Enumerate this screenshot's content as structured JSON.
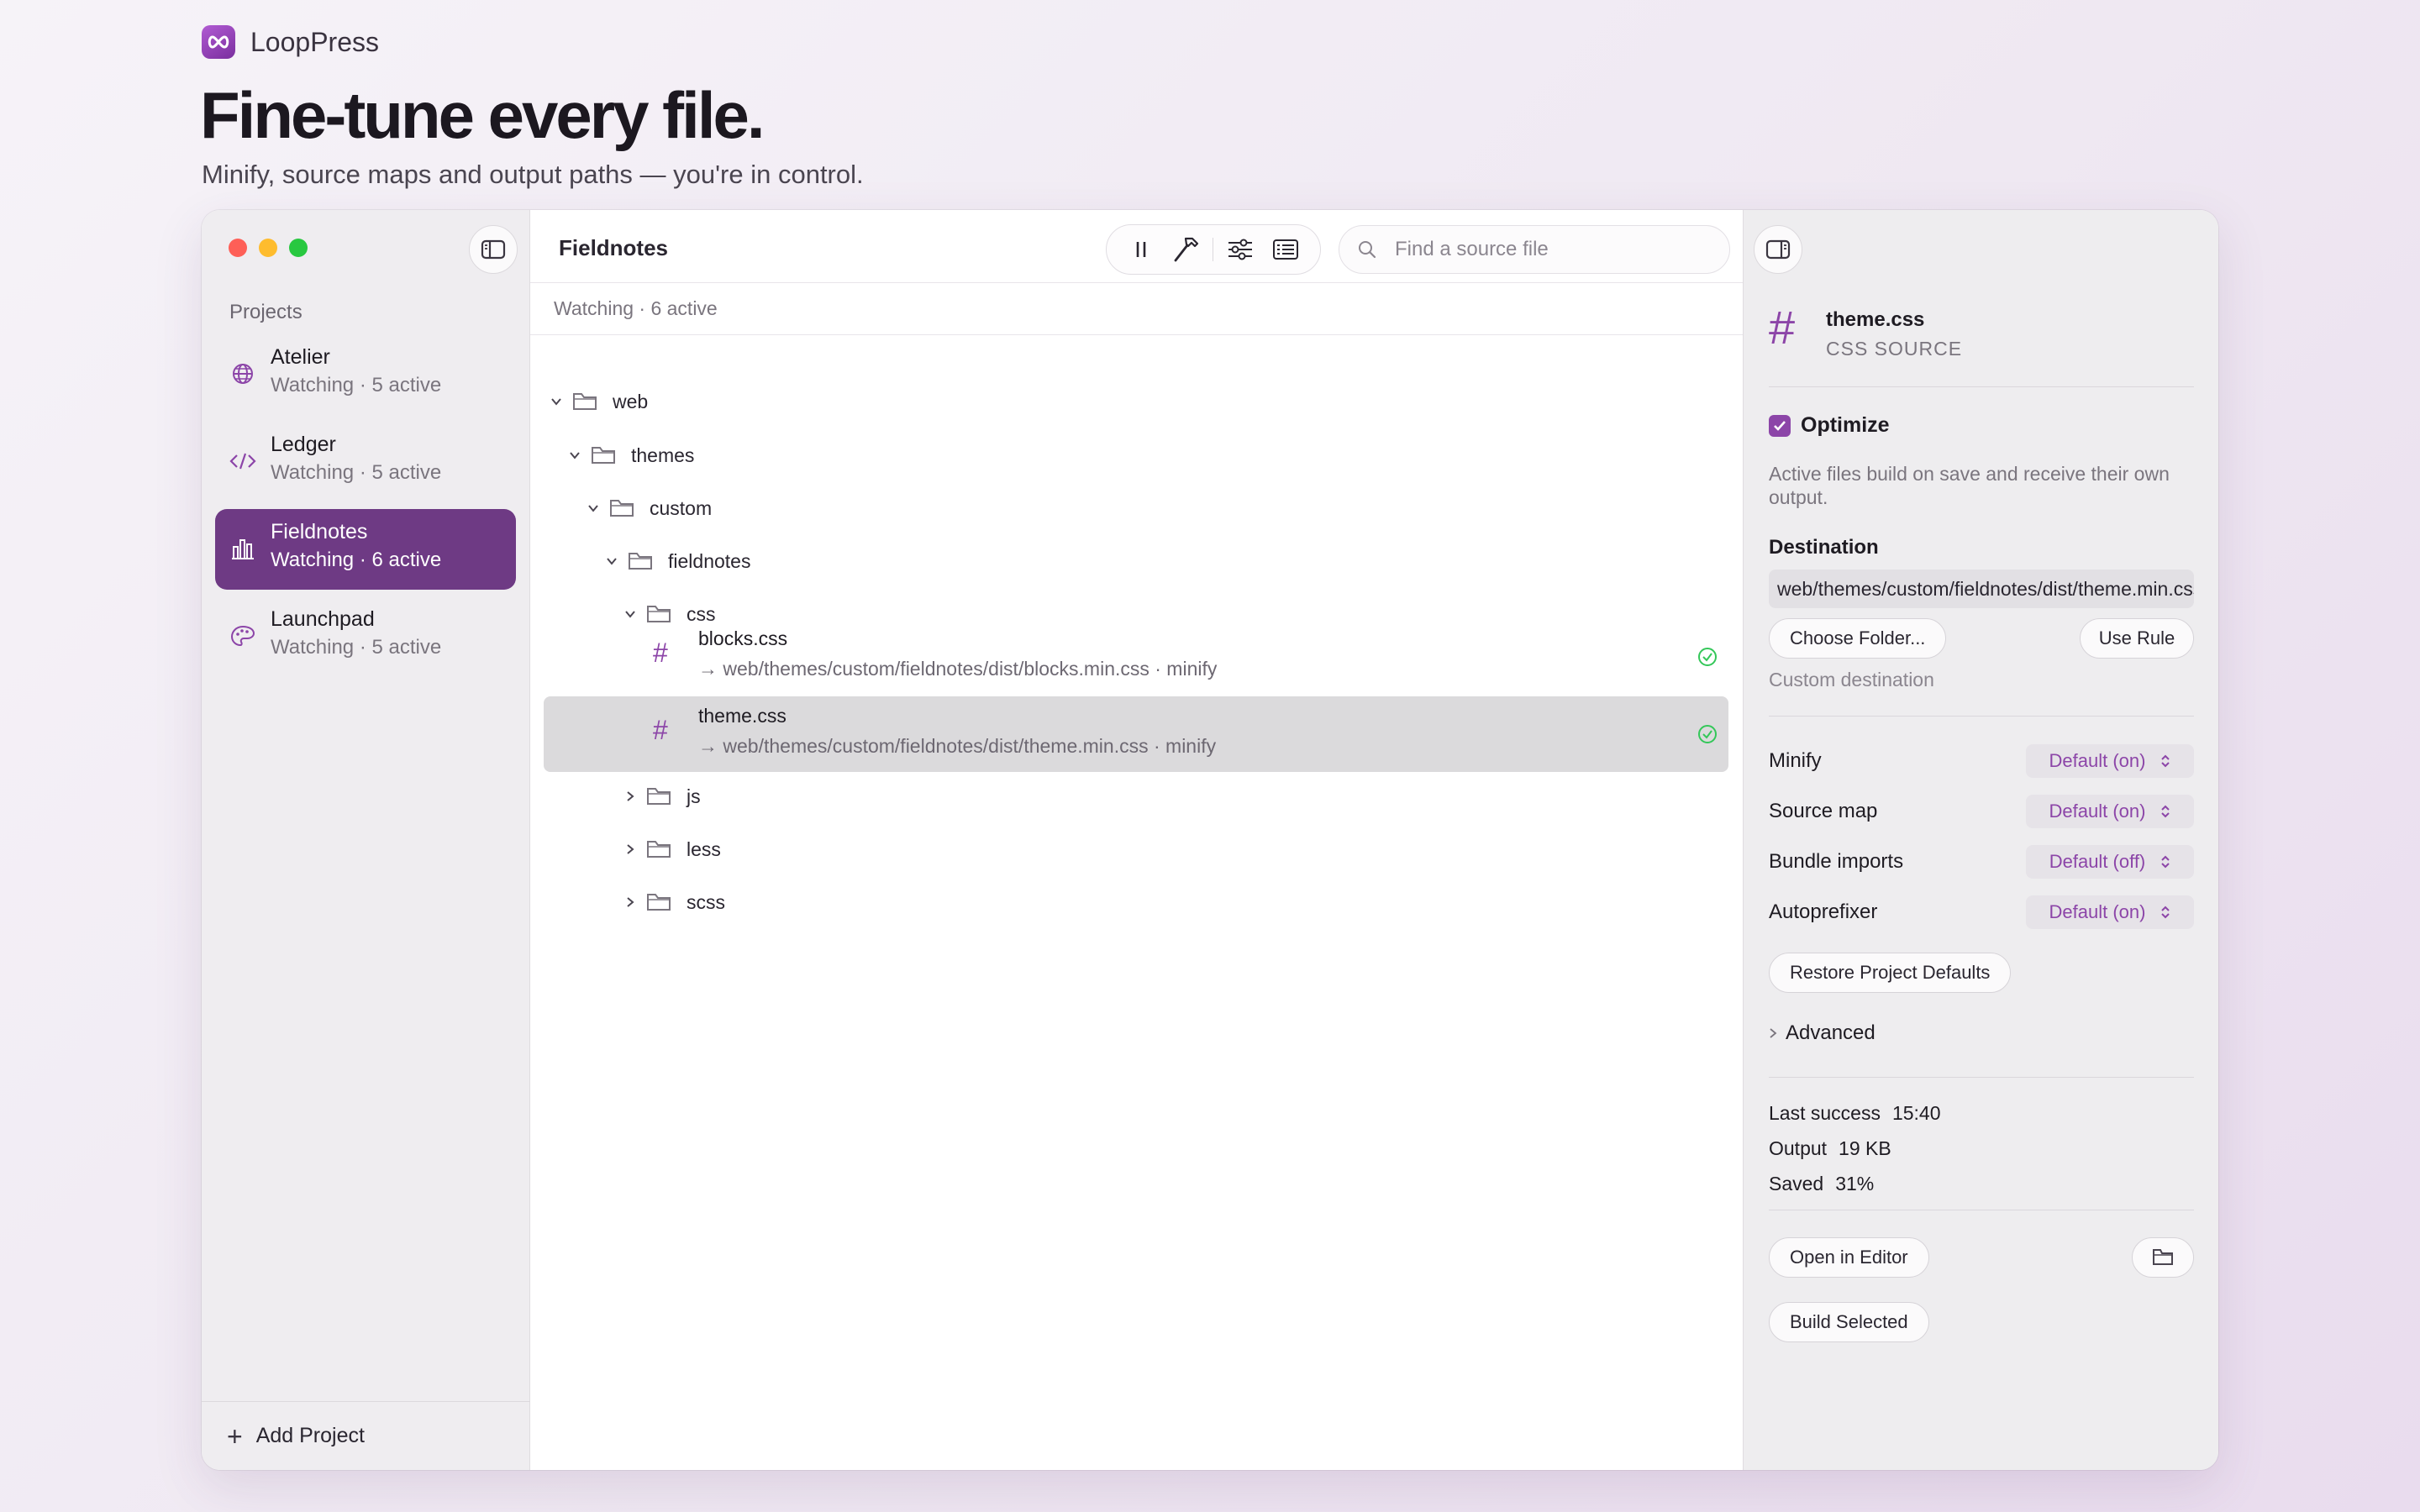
{
  "brand": {
    "name": "LoopPress"
  },
  "hero": {
    "title": "Fine-tune every file.",
    "subtitle": "Minify, source maps and output paths — you're in control."
  },
  "sidebar": {
    "heading": "Projects",
    "projects": [
      {
        "name": "Atelier",
        "status": "Watching · 5 active",
        "icon": "globe-icon"
      },
      {
        "name": "Ledger",
        "status": "Watching · 5 active",
        "icon": "code-icon"
      },
      {
        "name": "Fieldnotes",
        "status": "Watching · 6 active",
        "icon": "chart-icon",
        "active": true
      },
      {
        "name": "Launchpad",
        "status": "Watching · 5 active",
        "icon": "palette-icon"
      }
    ],
    "add_label": "Add Project"
  },
  "center": {
    "title": "Fieldnotes",
    "status": "Watching · 6 active",
    "search_placeholder": "Find a source file",
    "tree": {
      "folders": [
        "web",
        "themes",
        "custom",
        "fieldnotes",
        "css",
        "js",
        "less",
        "scss"
      ],
      "files": [
        {
          "name": "blocks.css",
          "path": "→ web/themes/custom/fieldnotes/dist/blocks.min.css · minify"
        },
        {
          "name": "theme.css",
          "path": "→ web/themes/custom/fieldnotes/dist/theme.min.css · minify"
        }
      ]
    }
  },
  "inspector": {
    "file_name": "theme.css",
    "file_kind": "CSS SOURCE",
    "optimize_label": "Optimize",
    "optimize_desc": "Active files build on save and receive their own output.",
    "destination_label": "Destination",
    "destination_value": "web/themes/custom/fieldnotes/dist/theme.min.css",
    "choose_folder": "Choose Folder...",
    "use_rule": "Use Rule",
    "custom_destination": "Custom destination",
    "settings": [
      {
        "label": "Minify",
        "value": "Default (on)"
      },
      {
        "label": "Source map",
        "value": "Default (on)"
      },
      {
        "label": "Bundle imports",
        "value": "Default (off)"
      },
      {
        "label": "Autoprefixer",
        "value": "Default (on)"
      }
    ],
    "restore": "Restore Project Defaults",
    "advanced": "Advanced",
    "stats": [
      {
        "key": "Last success",
        "value": "15:40"
      },
      {
        "key": "Output",
        "value": "19 KB"
      },
      {
        "key": "Saved",
        "value": "31%"
      }
    ],
    "open_editor": "Open in Editor",
    "build_selected": "Build Selected"
  },
  "colors": {
    "accent": "#8c45a8",
    "active_project": "#6e3a84",
    "success": "#34c759"
  }
}
